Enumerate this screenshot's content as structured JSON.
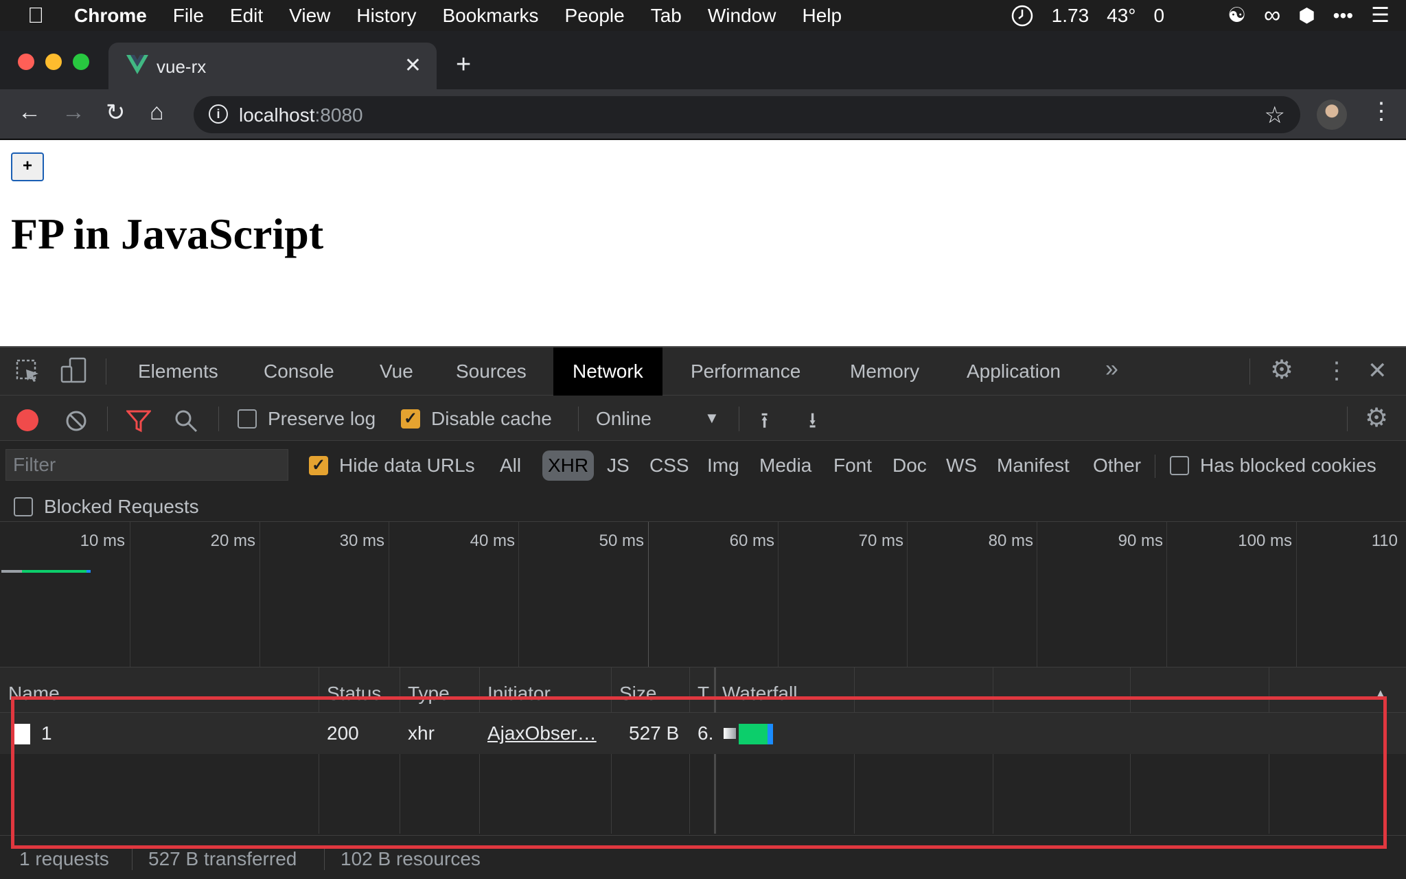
{
  "menubar": {
    "apple": "",
    "app": "Chrome",
    "items": [
      "File",
      "Edit",
      "View",
      "History",
      "Bookmarks",
      "People",
      "Tab",
      "Window",
      "Help"
    ],
    "status": {
      "load": "1.73",
      "temp": "43°",
      "count": "0"
    }
  },
  "browser": {
    "tab_title": "vue-rx",
    "url_host": "localhost",
    "url_port": ":8080"
  },
  "page": {
    "button_label": "+",
    "heading": "FP in JavaScript"
  },
  "devtools": {
    "tabs": [
      "Elements",
      "Console",
      "Vue",
      "Sources",
      "Network",
      "Performance",
      "Memory",
      "Application"
    ],
    "active_tab": "Network",
    "toolbar": {
      "preserve_log": "Preserve log",
      "disable_cache": "Disable cache",
      "throttling": "Online"
    },
    "filter": {
      "placeholder": "Filter",
      "hide_data_urls": "Hide data URLs",
      "types": [
        "All",
        "XHR",
        "JS",
        "CSS",
        "Img",
        "Media",
        "Font",
        "Doc",
        "WS",
        "Manifest",
        "Other"
      ],
      "active_type": "XHR",
      "has_blocked_cookies": "Has blocked cookies",
      "blocked_requests": "Blocked Requests"
    },
    "overview_ticks": [
      "10 ms",
      "20 ms",
      "30 ms",
      "40 ms",
      "50 ms",
      "60 ms",
      "70 ms",
      "80 ms",
      "90 ms",
      "100 ms",
      "110"
    ],
    "columns": [
      "Name",
      "Status",
      "Type",
      "Initiator",
      "Size",
      "T",
      "Waterfall"
    ],
    "rows": [
      {
        "name": "1",
        "status": "200",
        "type": "xhr",
        "initiator": "AjaxObser…",
        "size": "527 B",
        "time": "6."
      }
    ],
    "status_bar": {
      "requests": "1 requests",
      "transferred": "527 B transferred",
      "resources": "102 B resources"
    }
  },
  "colors": {
    "record": "#f04b4b",
    "checkbox_checked": "#e5a330",
    "highlight": "#e0373f",
    "waterfall_green": "#0cce6b",
    "waterfall_blue": "#1a8cff"
  }
}
